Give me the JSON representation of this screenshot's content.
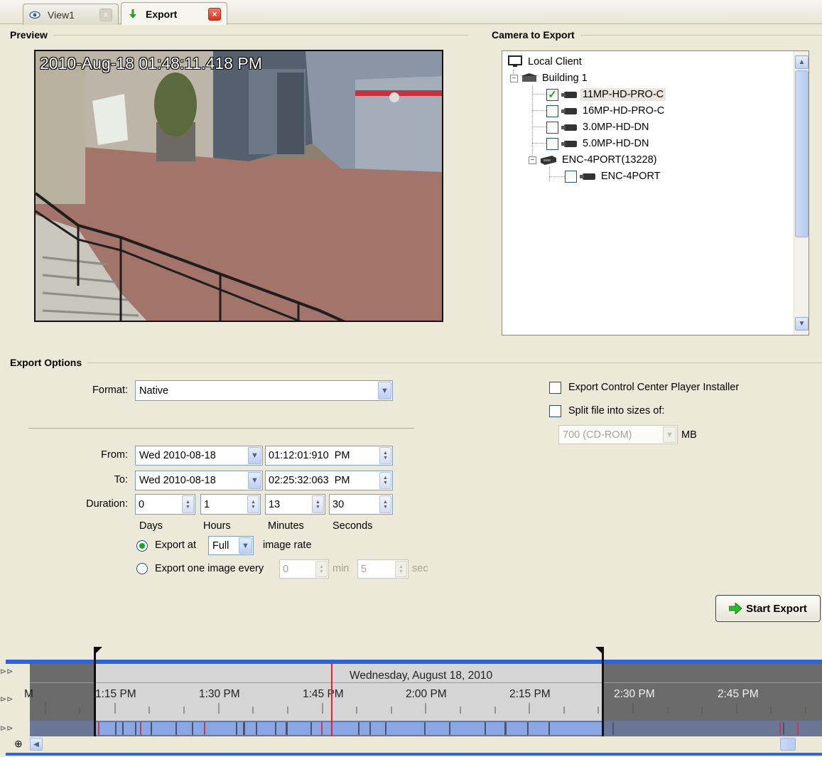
{
  "tabs": [
    {
      "label": "View1",
      "icon": "eye-icon",
      "active": false
    },
    {
      "label": "Export",
      "icon": "export-arrow-icon",
      "active": true
    }
  ],
  "preview": {
    "header": "Preview",
    "timestamp": "2010-Aug-18 01:48:11.418 PM"
  },
  "camera_tree": {
    "header": "Camera to Export",
    "root": "Local Client",
    "site": "Building 1",
    "cameras": [
      {
        "label": "11MP-HD-PRO-C",
        "checked": true
      },
      {
        "label": "16MP-HD-PRO-C",
        "checked": false
      },
      {
        "label": "3.0MP-HD-DN",
        "checked": false
      },
      {
        "label": "5.0MP-HD-DN",
        "checked": false
      }
    ],
    "encoder": "ENC-4PORT(13228)",
    "encoder_camera": {
      "label": "ENC-4PORT",
      "checked": false
    }
  },
  "export_options": {
    "header": "Export Options",
    "format_label": "Format:",
    "format_value": "Native",
    "from_label": "From:",
    "from_date": "Wed 2010-08-18",
    "from_time": "01:12:01:910  PM",
    "to_label": "To:",
    "to_date": "Wed 2010-08-18",
    "to_time": "02:25:32:063  PM",
    "duration_label": "Duration:",
    "duration": {
      "days": "0",
      "hours": "1",
      "minutes": "13",
      "seconds": "30"
    },
    "duration_units": {
      "days": "Days",
      "hours": "Hours",
      "minutes": "Minutes",
      "seconds": "Seconds"
    },
    "export_at_label": "Export at",
    "export_at_rate": "Full",
    "image_rate_label": "image rate",
    "export_at_selected": true,
    "export_one_label": "Export one image every",
    "export_one_min": "0",
    "min_label": "min",
    "export_one_sec": "5",
    "sec_label": "sec",
    "player_installer_label": "Export Control Center Player Installer",
    "player_installer_checked": false,
    "split_label": "Split file into sizes of:",
    "split_checked": false,
    "split_size": "700 (CD-ROM)",
    "split_unit": "MB",
    "start_button": "Start Export"
  },
  "timeline": {
    "date": "Wednesday, August 18, 2010",
    "left_partial": "M",
    "ticks": [
      "1:15 PM",
      "1:30 PM",
      "1:45 PM",
      "2:00 PM",
      "2:15 PM",
      "2:30 PM",
      "2:45 PM"
    ]
  }
}
